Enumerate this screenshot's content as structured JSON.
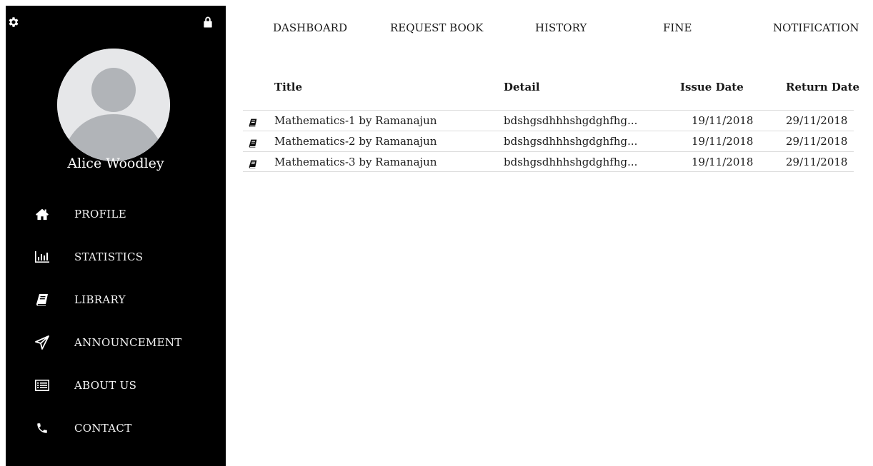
{
  "sidebar": {
    "user_name": "Alice Woodley",
    "icons": {
      "settings": "gear-icon",
      "lock": "lock-icon",
      "avatar": "user-avatar-placeholder"
    },
    "items": [
      {
        "label": "PROFILE",
        "icon": "home-icon"
      },
      {
        "label": "STATISTICS",
        "icon": "bar-chart-icon"
      },
      {
        "label": "LIBRARY",
        "icon": "book-icon"
      },
      {
        "label": "ANNOUNCEMENT",
        "icon": "paper-plane-icon"
      },
      {
        "label": "ABOUT US",
        "icon": "list-icon"
      },
      {
        "label": "CONTACT",
        "icon": "phone-icon"
      }
    ]
  },
  "topnav": {
    "items": [
      "DASHBOARD",
      "REQUEST BOOK",
      "HISTORY",
      "FINE",
      "NOTIFICATION"
    ]
  },
  "table": {
    "columns": [
      "Title",
      "Detail",
      "Issue Date",
      "Return Date"
    ],
    "rows": [
      {
        "title": "Mathematics-1 by Ramanajun",
        "detail": "bdshgsdhhhshgdghfhg...",
        "issue_date": "19/11/2018",
        "return_date": "29/11/2018",
        "icon": "book-icon"
      },
      {
        "title": "Mathematics-2 by Ramanajun",
        "detail": "bdshgsdhhhshgdghfhg...",
        "issue_date": "19/11/2018",
        "return_date": "29/11/2018",
        "icon": "book-icon"
      },
      {
        "title": "Mathematics-3 by Ramanajun",
        "detail": "bdshgsdhhhshgdghfhg...",
        "issue_date": "19/11/2018",
        "return_date": "29/11/2018",
        "icon": "book-icon"
      }
    ]
  },
  "colors": {
    "sidebar_bg": "#000000",
    "avatar_bg": "#e6e7e9",
    "avatar_figure": "#b1b4b8",
    "row_border": "#dcdcdc"
  }
}
